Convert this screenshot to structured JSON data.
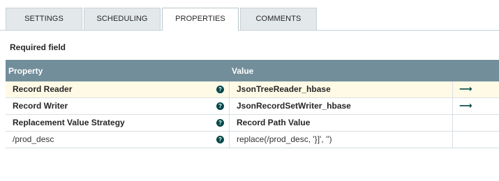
{
  "tabs": [
    {
      "label": "SETTINGS",
      "active": false
    },
    {
      "label": "SCHEDULING",
      "active": false
    },
    {
      "label": "PROPERTIES",
      "active": true
    },
    {
      "label": "COMMENTS",
      "active": false
    }
  ],
  "required_label": "Required field",
  "grid": {
    "columns": {
      "property": "Property",
      "value": "Value"
    },
    "rows": [
      {
        "name": "Record Reader",
        "value": "JsonTreeReader_hbase",
        "required": true,
        "help_icon": "question-circle-icon",
        "go_icon": "arrow-right-icon"
      },
      {
        "name": "Record Writer",
        "value": "JsonRecordSetWriter_hbase",
        "required": true,
        "help_icon": "question-circle-icon",
        "go_icon": "arrow-right-icon"
      },
      {
        "name": "Replacement Value Strategy",
        "value": "Record Path Value",
        "required": true,
        "help_icon": "question-circle-icon",
        "go_icon": ""
      },
      {
        "name": "/prod_desc",
        "value": "replace(/prod_desc, '}]', '')",
        "required": false,
        "help_icon": "question-circle-icon",
        "go_icon": ""
      }
    ]
  },
  "colors": {
    "header_bg": "#728e9b",
    "highlight_row": "#fffae6",
    "icon": "#004849",
    "tab_bg": "#e3e8eb"
  }
}
